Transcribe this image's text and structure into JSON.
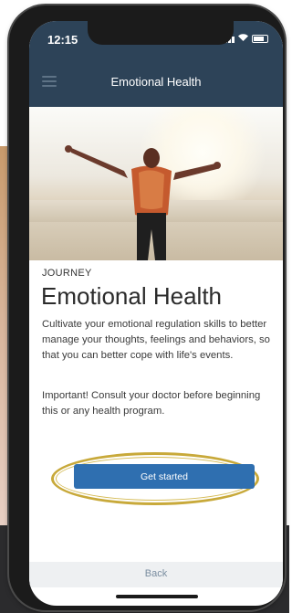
{
  "status_bar": {
    "time": "12:15"
  },
  "nav": {
    "title": "Emotional Health"
  },
  "content": {
    "eyebrow": "JOURNEY",
    "heading": "Emotional Health",
    "description": "Cultivate your emotional regulation skills to better manage your thoughts, feelings and behaviors, so that you can better cope with life's events.",
    "warning": "Important! Consult your doctor before beginning this or any health program."
  },
  "actions": {
    "get_started_label": "Get started",
    "back_label": "Back"
  },
  "colors": {
    "navbar": "#2d4358",
    "primary_button": "#2f6fb0",
    "highlight_ring": "#c8a93a"
  }
}
